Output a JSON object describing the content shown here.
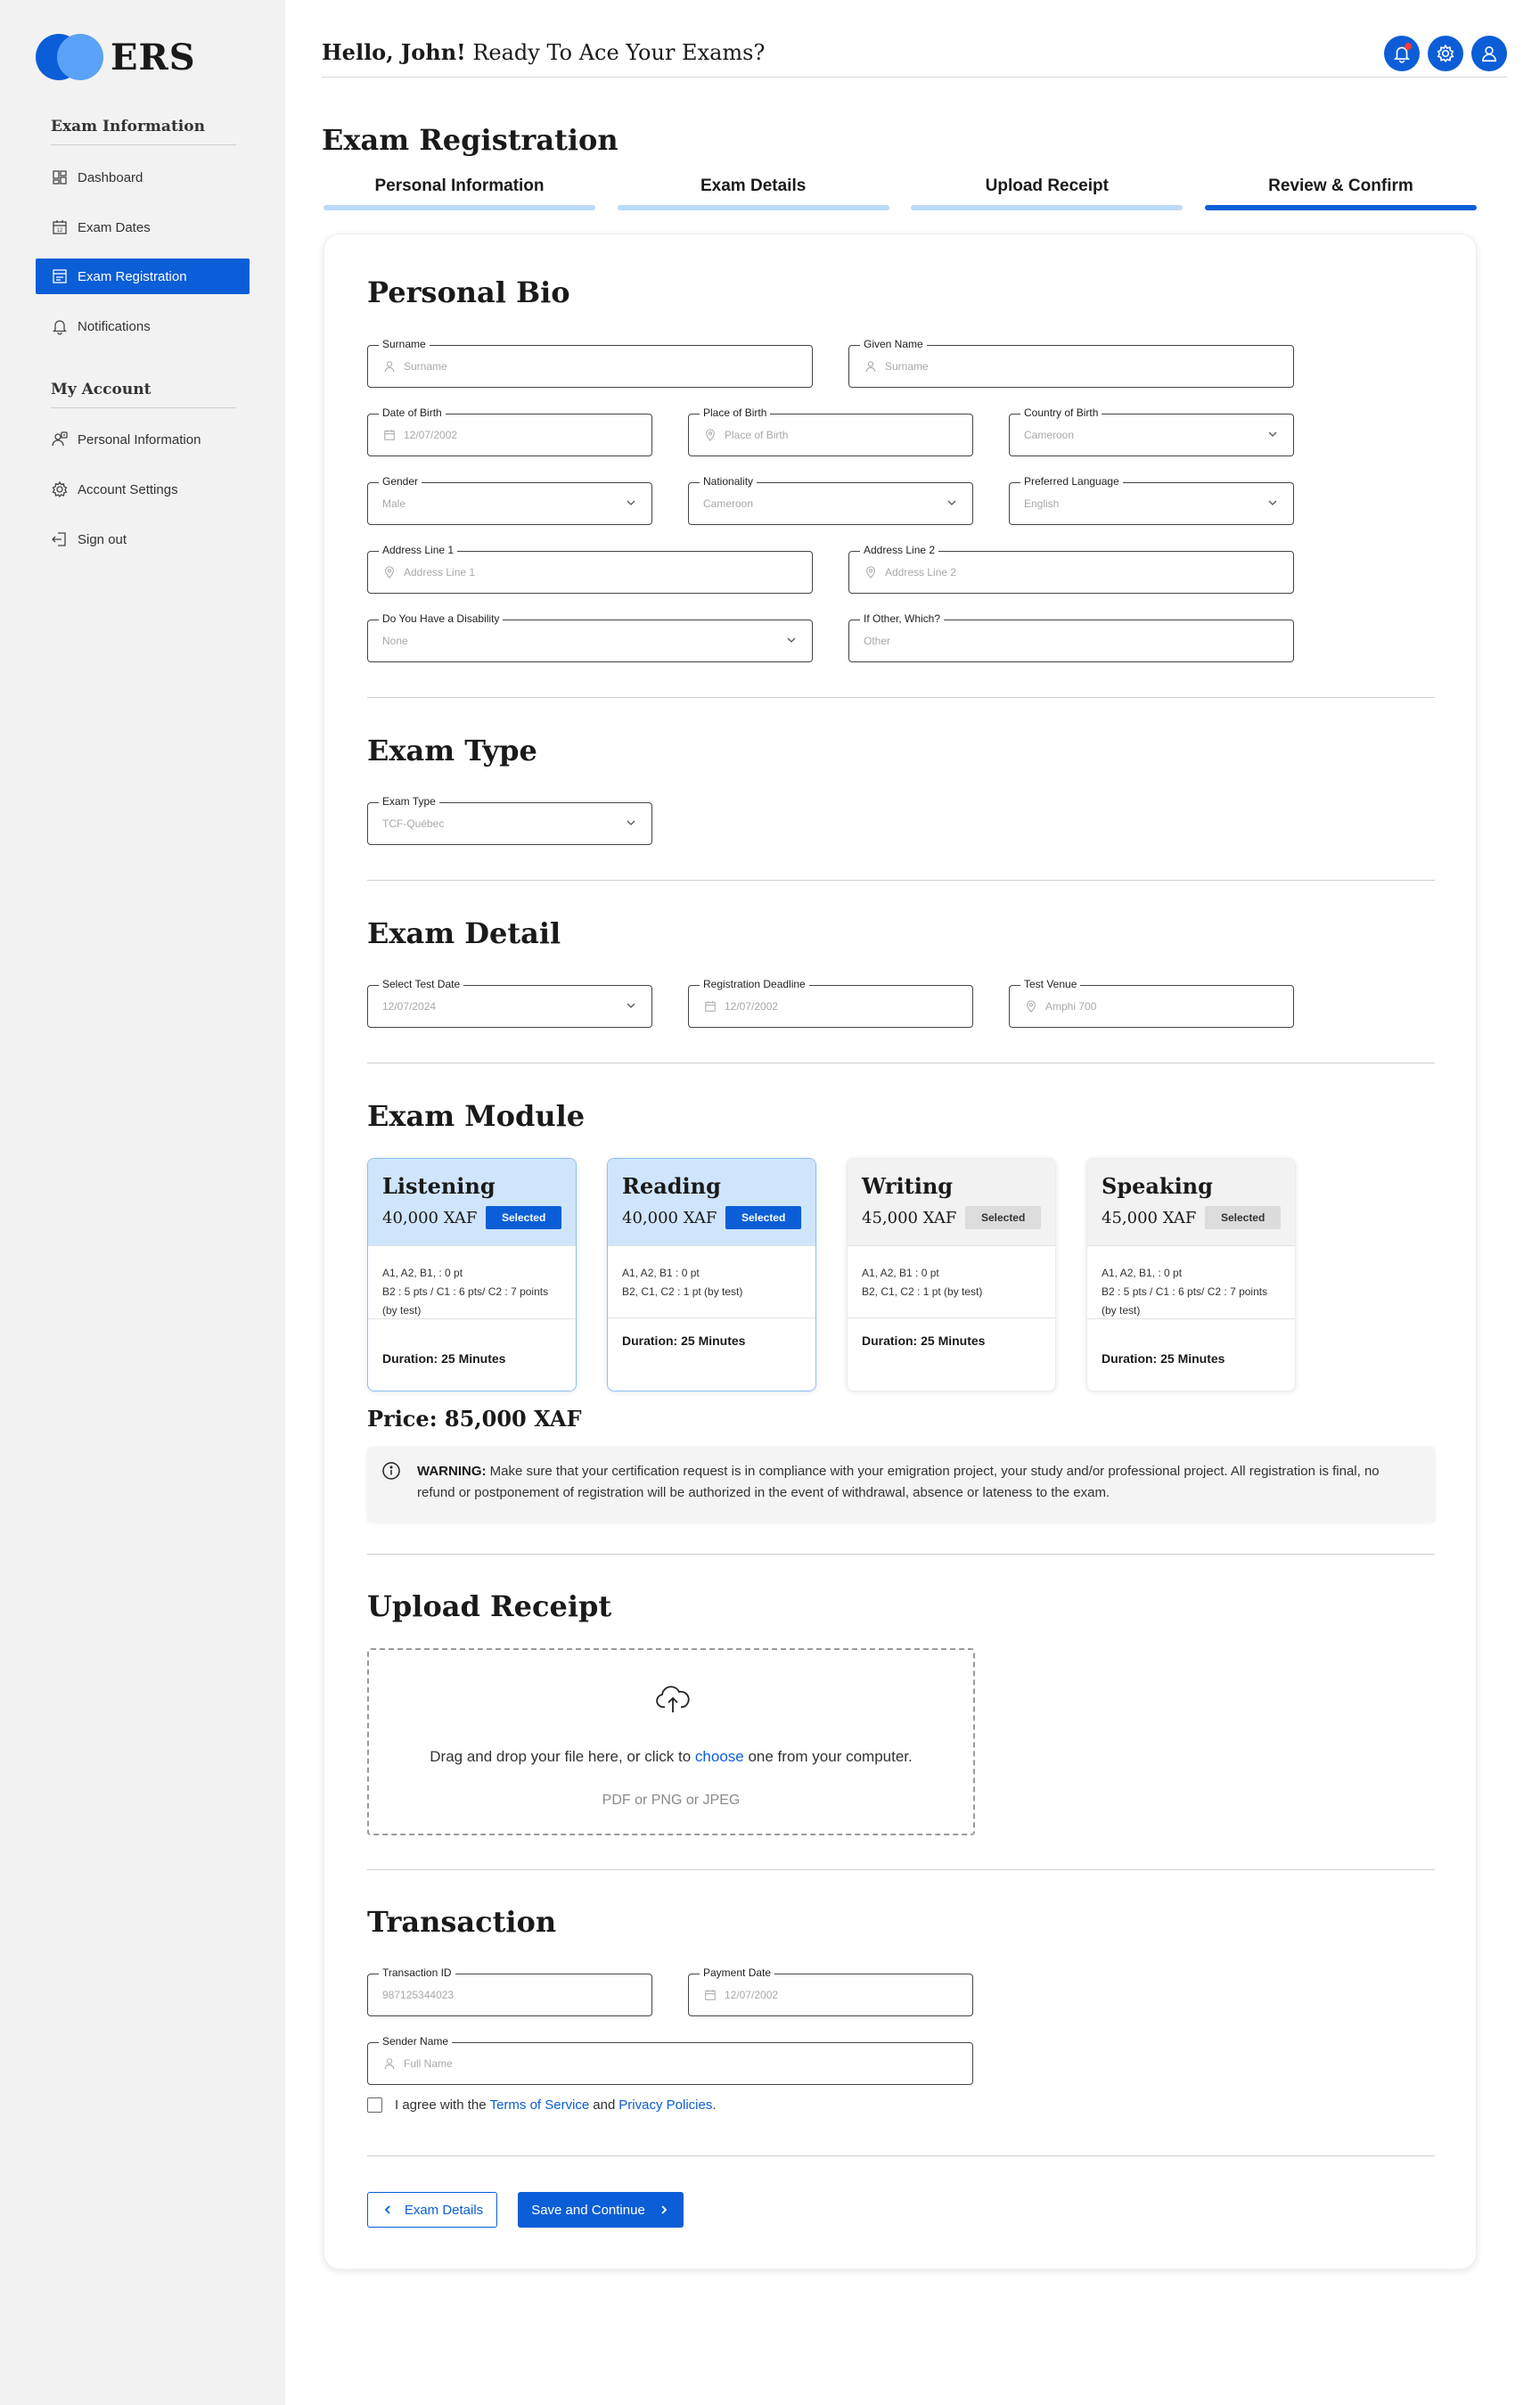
{
  "app": {
    "logo_text": "ERS"
  },
  "colors": {
    "primary": "#0b5ed7",
    "primary_light": "#cfe5fc",
    "step_inactive": "#bcdaf9",
    "sidebar_bg": "#f2f2f2"
  },
  "sidebar": {
    "section1": "Exam Information",
    "items1": [
      {
        "label": "Dashboard",
        "icon": "dashboard-icon",
        "active": false
      },
      {
        "label": "Exam Dates",
        "icon": "calendar-icon",
        "active": false
      },
      {
        "label": "Exam Registration",
        "icon": "registration-icon",
        "active": true
      },
      {
        "label": "Notifications",
        "icon": "bell-icon",
        "active": false
      }
    ],
    "section2": "My Account",
    "items2": [
      {
        "label": "Personal Information",
        "icon": "person-info-icon"
      },
      {
        "label": "Account Settings",
        "icon": "gear-icon"
      },
      {
        "label": "Sign out",
        "icon": "sign-out-icon"
      }
    ]
  },
  "header": {
    "greeting_bold": "Hello, John!",
    "greeting_rest": " Ready To Ace Your Exams?"
  },
  "page": {
    "title": "Exam Registration"
  },
  "steps": [
    {
      "label": "Personal Information",
      "active": false
    },
    {
      "label": "Exam Details",
      "active": false
    },
    {
      "label": "Upload Receipt",
      "active": false
    },
    {
      "label": "Review & Confirm",
      "active": true
    }
  ],
  "bio": {
    "title": "Personal Bio",
    "surname": {
      "label": "Surname",
      "placeholder": "Surname"
    },
    "given_name": {
      "label": "Given Name",
      "placeholder": "Surname"
    },
    "dob": {
      "label": "Date of Birth",
      "placeholder": "12/07/2002"
    },
    "pob": {
      "label": "Place of Birth",
      "placeholder": "Place of Birth"
    },
    "cob": {
      "label": "Country of Birth",
      "value": "Cameroon"
    },
    "gender": {
      "label": "Gender",
      "value": "Male"
    },
    "nationality": {
      "label": "Nationality",
      "value": "Cameroon"
    },
    "language": {
      "label": "Preferred Language",
      "value": "English"
    },
    "addr1": {
      "label": "Address Line 1",
      "placeholder": "Address Line 1"
    },
    "addr2": {
      "label": "Address Line 2",
      "placeholder": "Address Line 2"
    },
    "disability": {
      "label": "Do You Have a Disability",
      "value": "None"
    },
    "other": {
      "label": "If Other, Which?",
      "placeholder": "Other"
    }
  },
  "exam_type": {
    "title": "Exam Type",
    "label": "Exam Type",
    "value": "TCF-Québec"
  },
  "exam_detail": {
    "title": "Exam Detail",
    "test_date": {
      "label": "Select Test Date",
      "value": "12/07/2024"
    },
    "deadline": {
      "label": "Registration Deadline",
      "value": "12/07/2002"
    },
    "venue": {
      "label": "Test Venue",
      "value": "Amphi 700"
    }
  },
  "modules": {
    "title": "Exam Module",
    "items": [
      {
        "name": "Listening",
        "price": "40,000 XAF",
        "badge": "Selected",
        "selected": true,
        "desc1": "A1, A2, B1, : 0 pt",
        "desc2": "B2 : 5 pts / C1 : 6 pts/ C2 : 7 points",
        "desc3": "(by test)",
        "duration": "Duration: 25 Minutes"
      },
      {
        "name": "Reading",
        "price": "40,000 XAF",
        "badge": "Selected",
        "selected": true,
        "desc1": "A1, A2, B1 : 0 pt",
        "desc2": "B2, C1, C2 : 1 pt (by test)",
        "desc3": "",
        "duration": "Duration: 25 Minutes"
      },
      {
        "name": "Writing",
        "price": "45,000 XAF",
        "badge": "Selected",
        "selected": false,
        "desc1": "A1, A2, B1 : 0 pt",
        "desc2": "B2, C1, C2 : 1 pt (by test)",
        "desc3": "",
        "duration": "Duration: 25 Minutes"
      },
      {
        "name": "Speaking",
        "price": "45,000 XAF",
        "badge": "Selected",
        "selected": false,
        "desc1": "A1, A2, B1, : 0 pt",
        "desc2": "B2 : 5 pts / C1 : 6 pts/ C2 : 7 points",
        "desc3": "(by test)",
        "duration": "Duration: 25 Minutes"
      }
    ],
    "total": "Price: 85,000 XAF",
    "warning_label": "WARNING:",
    "warning_text": " Make sure that your certification request is in compliance with your emigration project, your study and/or professional project. All registration is final, no refund or postponement of registration will be authorized in the event of withdrawal, absence or lateness to the exam."
  },
  "upload": {
    "title": "Upload Receipt",
    "text_before": "Drag and drop your file here, or click to ",
    "link": "choose",
    "text_after": " one from your computer.",
    "formats": "PDF or PNG or JPEG"
  },
  "transaction": {
    "title": "Transaction",
    "txn_id": {
      "label": "Transaction ID",
      "value": "987125344023"
    },
    "pay_date": {
      "label": "Payment Date",
      "value": "12/07/2002"
    },
    "sender": {
      "label": "Sender Name",
      "placeholder": "Full Name"
    },
    "agree_before": "I agree with the",
    "terms": "Terms of Service",
    "and": "and",
    "privacy": "Privacy Policies",
    "agree_end": "."
  },
  "buttons": {
    "back": "Exam Details",
    "next": "Save and Continue"
  }
}
